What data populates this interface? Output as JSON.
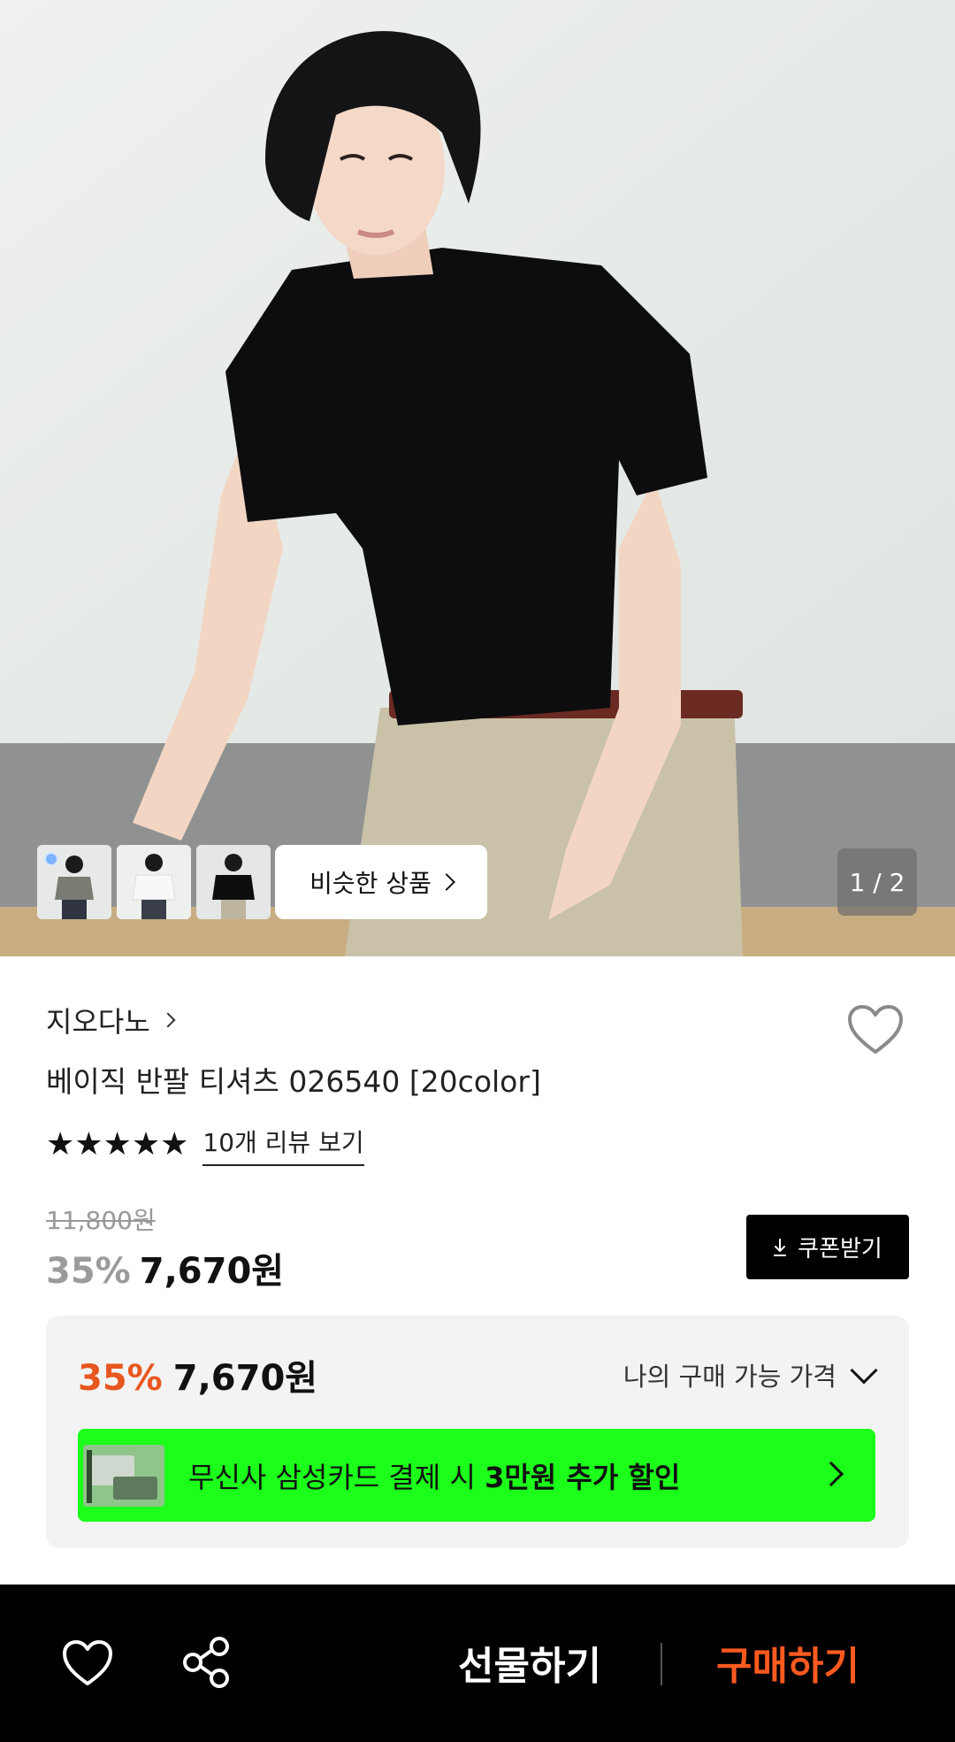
{
  "hero": {
    "similar_button_label": "비슷한 상품",
    "page_indicator": "1 / 2",
    "thumbnails": [
      "thumb-gray-tee",
      "thumb-white-tee",
      "thumb-black-tee"
    ]
  },
  "product": {
    "brand": "지오다노",
    "title": "베이직 반팔 티셔츠 026540 [20color]",
    "stars": "★★★★★",
    "rating": 5,
    "review_link": "10개 리뷰 보기",
    "original_price": "11,800원",
    "discount_pct": "35%",
    "sale_price": "7,670원",
    "coupon_label": "쿠폰받기"
  },
  "my_price": {
    "discount_pct": "35%",
    "price": "7,670원",
    "label": "나의 구매 가능 가격",
    "promo_text_prefix": "무신사 삼성카드 결제 시 ",
    "promo_text_bold": "3만원 추가 할인",
    "promo_color": "#1bff1b"
  },
  "bottom_bar": {
    "gift_label": "선물하기",
    "buy_label": "구매하기",
    "buy_color": "#ff5a1f"
  }
}
